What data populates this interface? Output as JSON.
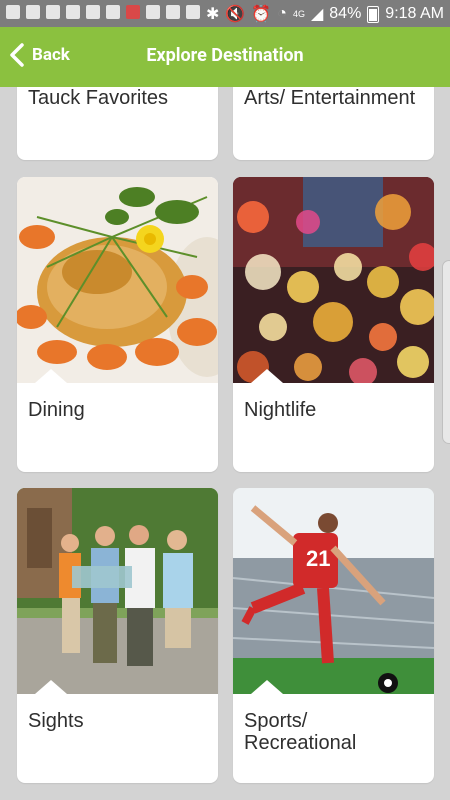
{
  "status_bar": {
    "battery_percent": "84%",
    "time": "9:18 AM",
    "signal_label": "4G",
    "icons": [
      "messages-icon",
      "chat-icon",
      "photo-icon",
      "shield-icon",
      "download-icon",
      "play-icon",
      "calendar-icon",
      "nyt-icon",
      "nyt-icon",
      "good-icon",
      "bluetooth-icon",
      "mute-icon",
      "alarm-icon",
      "wifi-icon",
      "signal-icon",
      "battery-icon"
    ]
  },
  "app_bar": {
    "back_label": "Back",
    "title": "Explore Destination",
    "color": "#8bc13f"
  },
  "categories": [
    {
      "label": "Tauck Favorites"
    },
    {
      "label": "Arts/ Entertainment"
    },
    {
      "label": "Dining"
    },
    {
      "label": "Nightlife"
    },
    {
      "label": "Sights"
    },
    {
      "label": "Sports/ Recreational"
    }
  ]
}
